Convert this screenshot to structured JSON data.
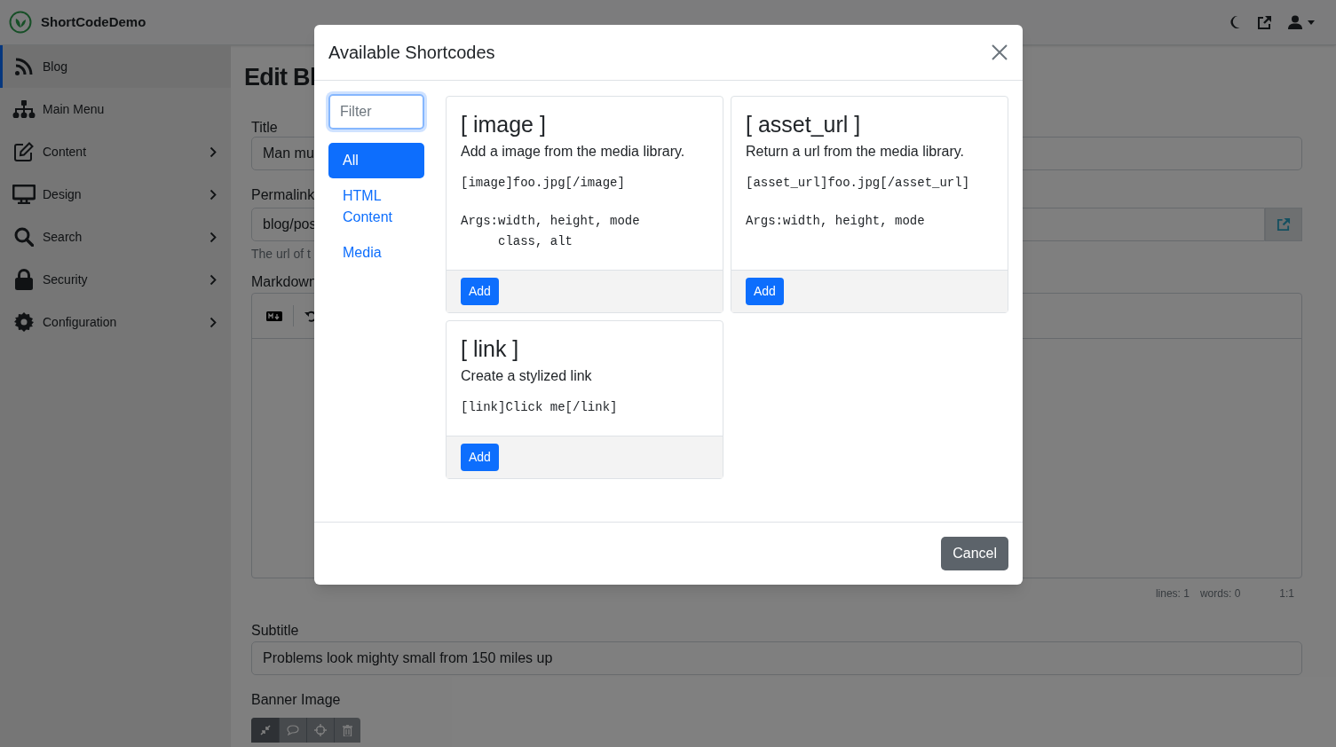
{
  "header": {
    "brand": "ShortCodeDemo"
  },
  "sidebar": {
    "items": [
      {
        "label": "Blog",
        "has_submenu": false,
        "selected": true
      },
      {
        "label": "Main Menu",
        "has_submenu": false,
        "selected": false
      },
      {
        "label": "Content",
        "has_submenu": true,
        "selected": false
      },
      {
        "label": "Design",
        "has_submenu": true,
        "selected": false
      },
      {
        "label": "Search",
        "has_submenu": true,
        "selected": false
      },
      {
        "label": "Security",
        "has_submenu": true,
        "selected": false
      },
      {
        "label": "Configuration",
        "has_submenu": true,
        "selected": false
      }
    ]
  },
  "page": {
    "heading": "Edit Bl",
    "title_label": "Title",
    "title_value": "Man mu",
    "permalink_label": "Permalink",
    "permalink_value": "blog/pos",
    "permalink_help": "The url of t",
    "markdown_label": "Markdown",
    "editor_status": {
      "lines": "lines: 1",
      "words": "words: 0",
      "cursor": "1:1"
    },
    "subtitle_label": "Subtitle",
    "subtitle_value": "Problems look mighty small from 150 miles up",
    "banner_label": "Banner Image"
  },
  "modal": {
    "title": "Available Shortcodes",
    "filter": {
      "placeholder": "Filter"
    },
    "categories": [
      {
        "label": "All",
        "selected": true
      },
      {
        "label": "HTML Content",
        "selected": false
      },
      {
        "label": "Media",
        "selected": false
      }
    ],
    "shortcodes": [
      {
        "name": "[ image ]",
        "description": "Add a image from the media library.",
        "example": "[image]foo.jpg[/image]",
        "args": "Args:width, height, mode\n     class, alt",
        "button": "Add"
      },
      {
        "name": "[ asset_url ]",
        "description": "Return a url from the media library.",
        "example": "[asset_url]foo.jpg[/asset_url]",
        "args": "Args:width, height, mode",
        "button": "Add"
      },
      {
        "name": "[ link ]",
        "description": "Create a stylized link",
        "example": "[link]Click me[/link]",
        "button": "Add"
      }
    ],
    "cancel": "Cancel"
  }
}
